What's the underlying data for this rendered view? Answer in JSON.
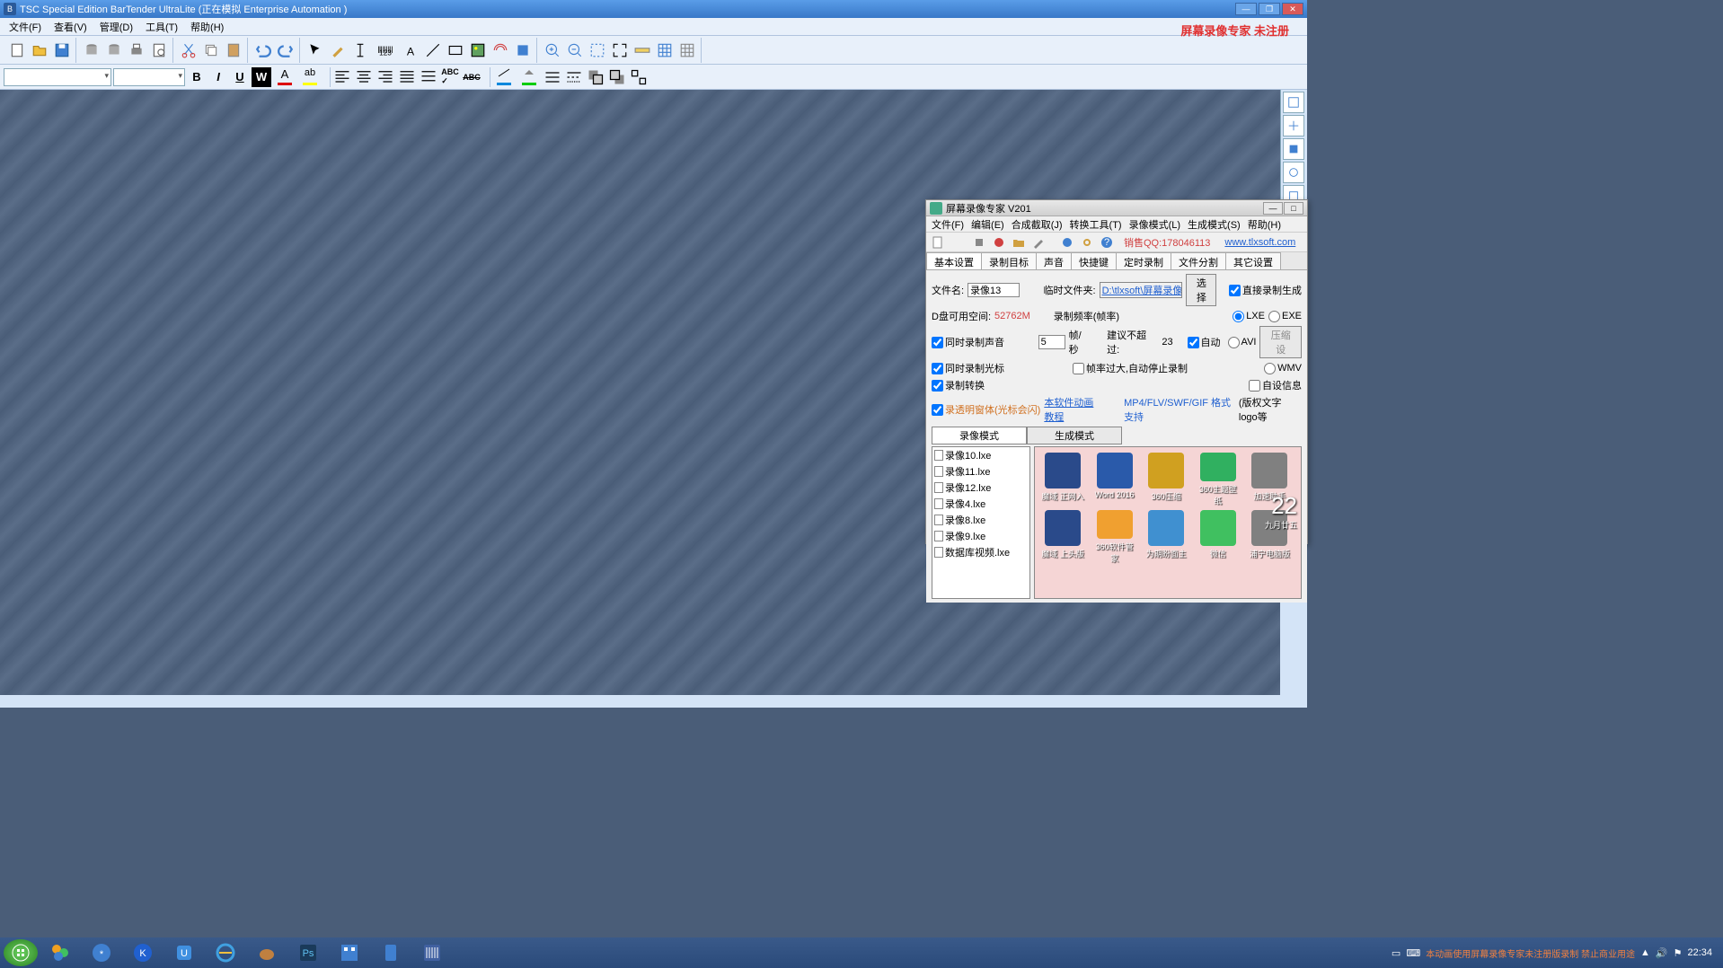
{
  "main": {
    "title": "TSC Special Edition BarTender UltraLite (正在模拟 Enterprise Automation )",
    "menus": [
      "文件(F)",
      "查看(V)",
      "管理(D)",
      "工具(T)",
      "帮助(H)"
    ],
    "watermark": "屏幕录像专家 未注册"
  },
  "recorder": {
    "title": "屏幕录像专家 V201",
    "menus": [
      "文件(F)",
      "编辑(E)",
      "合成截取(J)",
      "转换工具(T)",
      "录像模式(L)",
      "生成模式(S)",
      "帮助(H)"
    ],
    "sales": "销售QQ:178046113",
    "url": "www.tlxsoft.com",
    "tabs": [
      "基本设置",
      "录制目标",
      "声音",
      "快捷键",
      "定时录制",
      "文件分割",
      "其它设置"
    ],
    "filename_label": "文件名:",
    "filename": "录像13",
    "tempfolder_label": "临时文件夹:",
    "tempfolder": "D:\\tlxsoft\\屏幕录像专家",
    "select_btn": "选择",
    "diskspace_label": "D盘可用空间:",
    "diskspace": "52762M",
    "freq_label": "录制频率(帧率)",
    "fps_value": "5",
    "fps_unit": "帧/秒",
    "suggest_label": "建议不超过:",
    "suggest_value": "23",
    "auto_label": "自动",
    "overflow_label": "帧率过大,自动停止录制",
    "chk_sound": "同时录制声音",
    "chk_cursor": "同时录制光标",
    "chk_transform": "录制转换",
    "chk_transparent": "录透明窗体(光标会闪)",
    "tutorial_link": "本软件动画教程",
    "format_support": "MP4/FLV/SWF/GIF 格式支持",
    "direct_record": "直接录制生成",
    "fmt_lxe": "LXE",
    "fmt_exe": "EXE",
    "fmt_avi": "AVI",
    "fmt_wmv": "WMV",
    "compress_btn": "压缩设",
    "self_info": "自设信息",
    "copyright_text": "(版权文字 logo等",
    "mode_tabs": [
      "录像模式",
      "生成模式"
    ],
    "files": [
      "录像10.lxe",
      "录像11.lxe",
      "录像12.lxe",
      "录像4.lxe",
      "录像8.lxe",
      "录像9.lxe",
      "数据库视频.lxe"
    ],
    "preview_icons": [
      {
        "label": "魔域 正网入",
        "color": "#2a4a8a"
      },
      {
        "label": "Word 2016",
        "color": "#2a5aaa"
      },
      {
        "label": "360压缩",
        "color": "#d0a020"
      },
      {
        "label": "360主题壁纸",
        "color": "#30b060"
      },
      {
        "label": "加速助手",
        "color": "#808080"
      },
      {
        "label": "魔域 上头版",
        "color": "#2a4a8a"
      },
      {
        "label": "360软件管家",
        "color": "#f0a030"
      },
      {
        "label": "为期盼面主",
        "color": "#4090d0"
      },
      {
        "label": "微信",
        "color": "#40c060"
      },
      {
        "label": "浦宁电脑版",
        "color": "#808080"
      }
    ],
    "preview_clock": "22",
    "preview_date": "九月廿五"
  },
  "taskbar": {
    "time": "22:34",
    "notice": "本动画使用屏幕录像专家未注册版录制 禁止商业用途"
  }
}
